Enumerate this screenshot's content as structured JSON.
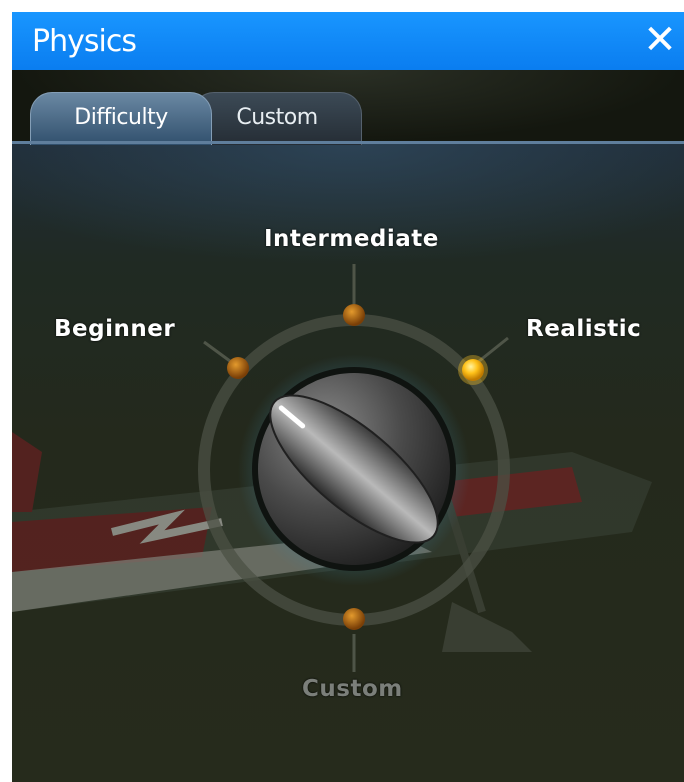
{
  "window": {
    "title": "Physics",
    "close_glyph": "✕"
  },
  "tabs": [
    {
      "label": "Difficulty",
      "active": true
    },
    {
      "label": "Custom",
      "active": false
    }
  ],
  "dial": {
    "options": [
      {
        "label": "Beginner",
        "selected": false
      },
      {
        "label": "Intermediate",
        "selected": false
      },
      {
        "label": "Realistic",
        "selected": true
      },
      {
        "label": "Custom",
        "selected": false
      }
    ]
  },
  "colors": {
    "titlebar": "#0a7df0",
    "indicator_on": "#ffc21a",
    "indicator_off": "#b5650d",
    "tab_active": "#4d6d8b"
  },
  "icons": {
    "close": "close-icon",
    "knob": "dial-knob"
  }
}
